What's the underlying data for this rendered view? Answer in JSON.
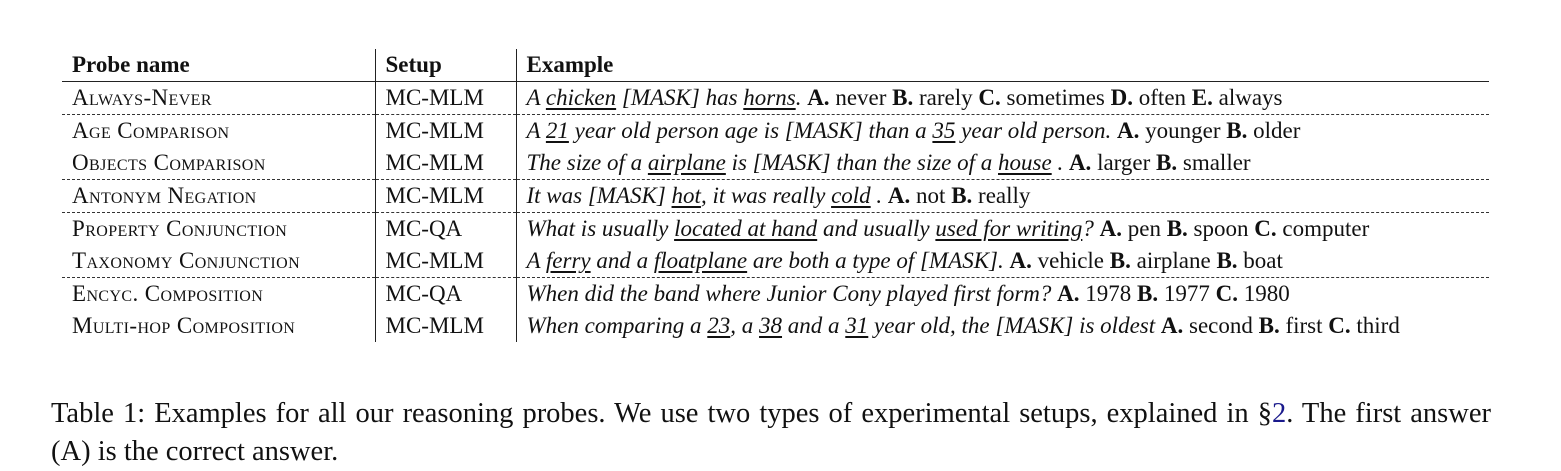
{
  "table": {
    "headers": [
      "Probe name",
      "Setup",
      "Example"
    ],
    "rows": [
      {
        "probe": "Always-Never",
        "setup": "MC-MLM",
        "dash_after": true,
        "example": [
          {
            "t": "A ",
            "i": true
          },
          {
            "t": "chicken",
            "i": true,
            "u": true
          },
          {
            "t": " [MASK] has ",
            "i": true
          },
          {
            "t": "horns",
            "i": true,
            "u": true
          },
          {
            "t": ". ",
            "i": true
          },
          {
            "t": "A.",
            "b": true
          },
          {
            "t": " never "
          },
          {
            "t": "B.",
            "b": true
          },
          {
            "t": " rarely "
          },
          {
            "t": "C.",
            "b": true
          },
          {
            "t": " sometimes "
          },
          {
            "t": "D.",
            "b": true
          },
          {
            "t": " often "
          },
          {
            "t": "E.",
            "b": true
          },
          {
            "t": " always"
          }
        ]
      },
      {
        "probe": "Age Comparison",
        "setup": "MC-MLM",
        "dash_after": false,
        "example": [
          {
            "t": "A ",
            "i": true
          },
          {
            "t": "21",
            "i": true,
            "u": true
          },
          {
            "t": " year old person age is [MASK] than a ",
            "i": true
          },
          {
            "t": "35",
            "i": true,
            "u": true
          },
          {
            "t": " year old person. ",
            "i": true
          },
          {
            "t": "A.",
            "b": true
          },
          {
            "t": " younger "
          },
          {
            "t": "B.",
            "b": true
          },
          {
            "t": " older"
          }
        ]
      },
      {
        "probe": "Objects Comparison",
        "setup": "MC-MLM",
        "dash_after": true,
        "example": [
          {
            "t": "The size of a ",
            "i": true
          },
          {
            "t": "airplane",
            "i": true,
            "u": true
          },
          {
            "t": " is [MASK] than the size of a ",
            "i": true
          },
          {
            "t": "house",
            "i": true,
            "u": true
          },
          {
            "t": " . ",
            "i": true
          },
          {
            "t": "A.",
            "b": true
          },
          {
            "t": " larger "
          },
          {
            "t": "B.",
            "b": true
          },
          {
            "t": " smaller"
          }
        ]
      },
      {
        "probe": "Antonym Negation",
        "setup": "MC-MLM",
        "dash_after": true,
        "example": [
          {
            "t": "It was [MASK] ",
            "i": true
          },
          {
            "t": "hot",
            "i": true,
            "u": true
          },
          {
            "t": ", it was really ",
            "i": true
          },
          {
            "t": "cold",
            "i": true,
            "u": true
          },
          {
            "t": " . ",
            "i": true
          },
          {
            "t": "A.",
            "b": true
          },
          {
            "t": " not "
          },
          {
            "t": "B.",
            "b": true
          },
          {
            "t": " really"
          }
        ]
      },
      {
        "probe": "Property Conjunction",
        "setup": "MC-QA",
        "dash_after": false,
        "example": [
          {
            "t": "What is usually ",
            "i": true
          },
          {
            "t": "located at hand",
            "i": true,
            "u": true
          },
          {
            "t": " and usually ",
            "i": true
          },
          {
            "t": "used for writing",
            "i": true,
            "u": true
          },
          {
            "t": "? ",
            "i": true
          },
          {
            "t": "A.",
            "b": true
          },
          {
            "t": " pen "
          },
          {
            "t": "B.",
            "b": true
          },
          {
            "t": " spoon "
          },
          {
            "t": "C.",
            "b": true
          },
          {
            "t": " computer"
          }
        ]
      },
      {
        "probe": "Taxonomy Conjunction",
        "setup": "MC-MLM",
        "dash_after": true,
        "example": [
          {
            "t": "A ",
            "i": true
          },
          {
            "t": "ferry",
            "i": true,
            "u": true
          },
          {
            "t": " and a ",
            "i": true
          },
          {
            "t": "floatplane",
            "i": true,
            "u": true
          },
          {
            "t": " are both a type of [MASK]. ",
            "i": true
          },
          {
            "t": "A.",
            "b": true
          },
          {
            "t": " vehicle "
          },
          {
            "t": "B.",
            "b": true
          },
          {
            "t": " airplane "
          },
          {
            "t": "B.",
            "b": true
          },
          {
            "t": " boat"
          }
        ]
      },
      {
        "probe": "Encyc. Composition",
        "setup": "MC-QA",
        "dash_after": false,
        "example": [
          {
            "t": "When did the band where Junior Cony played first form? ",
            "i": true
          },
          {
            "t": "A.",
            "b": true
          },
          {
            "t": " 1978 "
          },
          {
            "t": "B.",
            "b": true
          },
          {
            "t": " 1977 "
          },
          {
            "t": "C.",
            "b": true
          },
          {
            "t": " 1980"
          }
        ]
      },
      {
        "probe": "Multi-hop Composition",
        "setup": "MC-MLM",
        "dash_after": false,
        "example": [
          {
            "t": "When comparing a ",
            "i": true
          },
          {
            "t": "23",
            "i": true,
            "u": true
          },
          {
            "t": ", a ",
            "i": true
          },
          {
            "t": "38",
            "i": true,
            "u": true
          },
          {
            "t": " and a ",
            "i": true
          },
          {
            "t": "31",
            "i": true,
            "u": true
          },
          {
            "t": " year old, the [MASK] is oldest ",
            "i": true
          },
          {
            "t": "A.",
            "b": true
          },
          {
            "t": " second "
          },
          {
            "t": "B.",
            "b": true
          },
          {
            "t": " first "
          },
          {
            "t": "C.",
            "b": true
          },
          {
            "t": " third"
          }
        ]
      }
    ]
  },
  "caption": {
    "before": "Table 1: Examples for all our reasoning probes. We use two types of experimental setups, explained in §",
    "ref": "2",
    "after": ". The first answer (A) is the correct answer."
  }
}
